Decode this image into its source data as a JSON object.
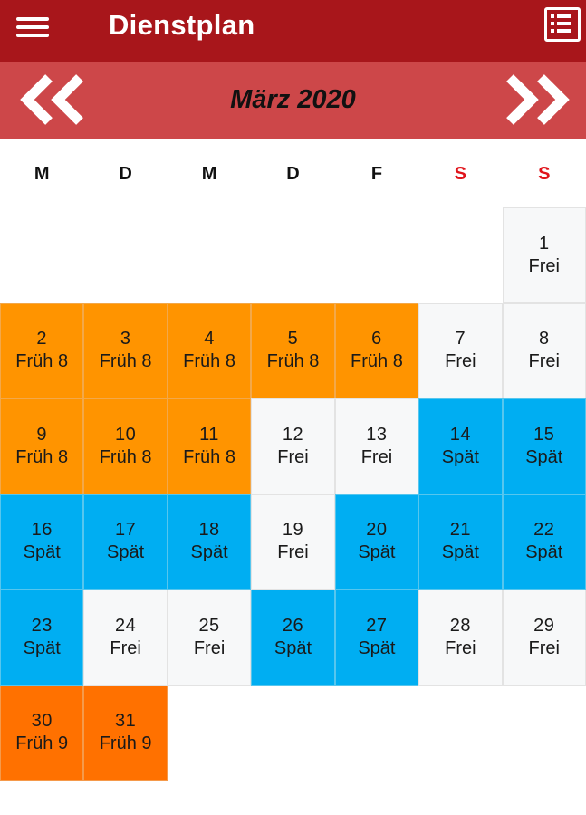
{
  "app_bar": {
    "title": "Dienstplan",
    "menu_icon": "hamburger-menu-icon",
    "list_icon": "list-view-icon"
  },
  "month_nav": {
    "title": "März 2020",
    "prev_icon": "double-chevron-left-icon",
    "next_icon": "double-chevron-right-icon"
  },
  "weekdays": [
    "M",
    "D",
    "M",
    "D",
    "F",
    "S",
    "S"
  ],
  "colors": {
    "app_bar": "#a8161b",
    "month_bar": "#cd4749",
    "weekend_label": "#e0141b",
    "frei": "#f7f8f9",
    "frueh_8": "#ff9400",
    "spaet": "#00aef2",
    "frueh_9": "#ff7100"
  },
  "calendar": {
    "leading_empty_cells": 6,
    "days": [
      {
        "day": "1",
        "shift": "Frei",
        "type": "frei"
      },
      {
        "day": "2",
        "shift": "Früh 8",
        "type": "frueh8"
      },
      {
        "day": "3",
        "shift": "Früh 8",
        "type": "frueh8"
      },
      {
        "day": "4",
        "shift": "Früh 8",
        "type": "frueh8"
      },
      {
        "day": "5",
        "shift": "Früh 8",
        "type": "frueh8"
      },
      {
        "day": "6",
        "shift": "Früh 8",
        "type": "frueh8"
      },
      {
        "day": "7",
        "shift": "Frei",
        "type": "frei"
      },
      {
        "day": "8",
        "shift": "Frei",
        "type": "frei"
      },
      {
        "day": "9",
        "shift": "Früh 8",
        "type": "frueh8"
      },
      {
        "day": "10",
        "shift": "Früh 8",
        "type": "frueh8"
      },
      {
        "day": "11",
        "shift": "Früh 8",
        "type": "frueh8"
      },
      {
        "day": "12",
        "shift": "Frei",
        "type": "frei"
      },
      {
        "day": "13",
        "shift": "Frei",
        "type": "frei"
      },
      {
        "day": "14",
        "shift": "Spät",
        "type": "spaet"
      },
      {
        "day": "15",
        "shift": "Spät",
        "type": "spaet"
      },
      {
        "day": "16",
        "shift": "Spät",
        "type": "spaet"
      },
      {
        "day": "17",
        "shift": "Spät",
        "type": "spaet"
      },
      {
        "day": "18",
        "shift": "Spät",
        "type": "spaet"
      },
      {
        "day": "19",
        "shift": "Frei",
        "type": "frei"
      },
      {
        "day": "20",
        "shift": "Spät",
        "type": "spaet"
      },
      {
        "day": "21",
        "shift": "Spät",
        "type": "spaet"
      },
      {
        "day": "22",
        "shift": "Spät",
        "type": "spaet"
      },
      {
        "day": "23",
        "shift": "Spät",
        "type": "spaet"
      },
      {
        "day": "24",
        "shift": "Frei",
        "type": "frei"
      },
      {
        "day": "25",
        "shift": "Frei",
        "type": "frei"
      },
      {
        "day": "26",
        "shift": "Spät",
        "type": "spaet"
      },
      {
        "day": "27",
        "shift": "Spät",
        "type": "spaet"
      },
      {
        "day": "28",
        "shift": "Frei",
        "type": "frei"
      },
      {
        "day": "29",
        "shift": "Frei",
        "type": "frei"
      },
      {
        "day": "30",
        "shift": "Früh 9",
        "type": "frueh9"
      },
      {
        "day": "31",
        "shift": "Früh 9",
        "type": "frueh9"
      }
    ]
  }
}
